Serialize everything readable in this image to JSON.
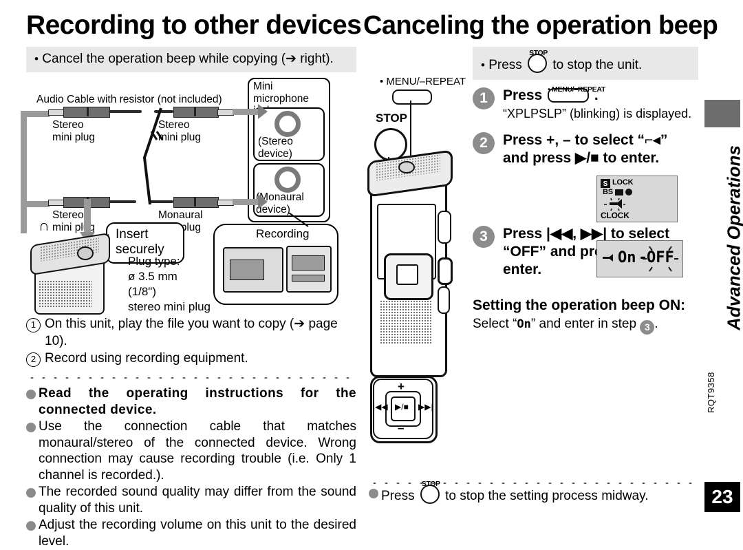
{
  "left": {
    "title": "Recording to other devices",
    "note": {
      "bullet": "•",
      "text": "Cancel the operation beep while copying (➔ right)."
    },
    "diagram": {
      "mini_mic_jack_label": "Mini microphone jack",
      "cable_label": "Audio Cable with resistor (not included)",
      "plug_left_top_line1": "Stereo",
      "plug_left_top_line2": "mini plug",
      "plug_right_top_line1": "Stereo",
      "plug_right_top_line2": "mini plug",
      "plug_left_bottom_line1": "Stereo",
      "plug_left_bottom_line2": "mini plug",
      "plug_right_bottom_line1": "Monaural",
      "plug_right_bottom_line2": "mini plug",
      "stereo_device": "(Stereo device)",
      "monaural_device": "(Monaural device)",
      "callout_line1": "Insert",
      "callout_line2": "securely",
      "plug_type_line1": "Plug type:",
      "plug_type_line2": "ø 3.5 mm",
      "plug_type_line3": "(1/8\")",
      "plug_type_line4": "stereo mini plug",
      "recording_label": "Recording",
      "headphone_icon": "∩"
    },
    "steps": [
      {
        "num": "1",
        "text": "On this unit, play the file you want to copy (➔ page 10)."
      },
      {
        "num": "2",
        "text": "Record using recording equipment."
      }
    ],
    "bullets": [
      {
        "bold": true,
        "text": "Read  the  operating  instructions  for  the connected device."
      },
      {
        "bold": false,
        "text": "Use the connection cable that matches monaural/stereo of the connected device. Wrong connection may cause recording trouble (i.e. Only 1 channel is recorded.)."
      },
      {
        "bold": false,
        "text": "The recorded sound quality may differ from the sound quality of this unit."
      },
      {
        "bold": false,
        "text": "Adjust the recording volume on this unit to the desired level."
      }
    ]
  },
  "right": {
    "title": "Canceling the operation beep",
    "note": {
      "bullet": "•",
      "press_word": "Press",
      "stop_label": "STOP",
      "tail": "to stop the unit."
    },
    "device": {
      "menu_repeat_label": "• MENU/–REPEAT",
      "stop_label": "STOP",
      "pad_plus": "+",
      "pad_minus": "–",
      "pad_prev": "|◀◀",
      "pad_next": "▶▶|",
      "pad_play": "▶/■"
    },
    "steps": [
      {
        "num": "1",
        "title_prefix": "Press",
        "key_label": "• MENU/–REPEAT",
        "title_suffix": ".",
        "sub": "“XPLPSLP” (blinking) is displayed."
      },
      {
        "num": "2",
        "line1": "Press +, – to select “⌐◂”",
        "line2": "and press ▶/■ to enter."
      },
      {
        "num": "3",
        "line1": "Press |◀◀, ▶▶| to select",
        "line2": "“OFF” and press ▶/■ to",
        "line3": "enter."
      }
    ],
    "lcd_top": {
      "lock": "LOCK",
      "bs": "BS",
      "clock": "CLOCK"
    },
    "lcd_bottom": {
      "on": "On",
      "dash": "-",
      "off": "OFF"
    },
    "setting_on": {
      "heading": "Setting the operation beep ON:",
      "text_before": "Select “",
      "value": "On",
      "text_after": "” and enter in step",
      "step_num": "3",
      "period": "."
    },
    "footer": {
      "press_word": "Press",
      "stop_label": "STOP",
      "tail": "to stop the setting process midway."
    }
  },
  "sidebar": {
    "section_title": "Advanced Operations",
    "doc_code": "RQT9358",
    "page_number": "23"
  }
}
